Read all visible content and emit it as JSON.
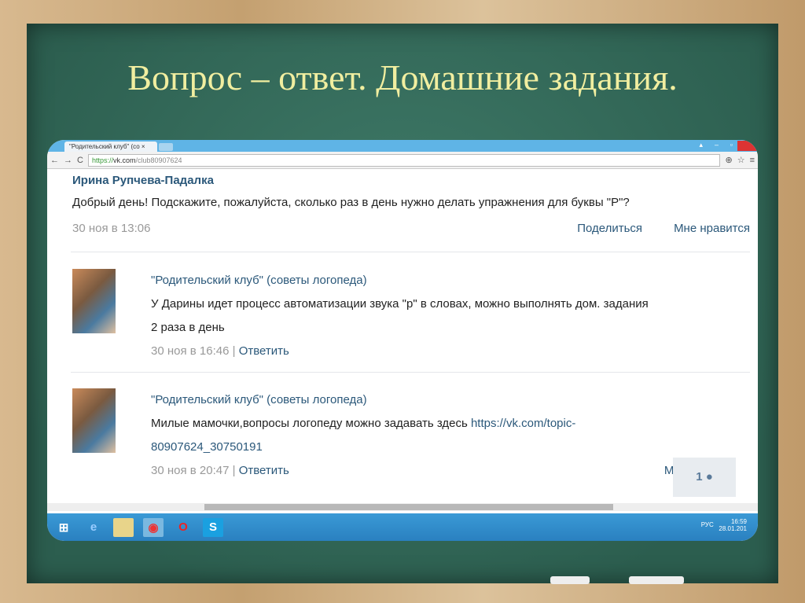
{
  "slide": {
    "title": "Вопрос – ответ. Домашние задания."
  },
  "browser": {
    "tab_title": "\"Родительский клуб\" (со",
    "url_scheme": "https://",
    "url_host": "vk.com",
    "url_path": "/club80907624"
  },
  "question": {
    "author": "Ирина Рупчева-Падалка",
    "text": "Добрый день! Подскажите, пожалуйста, сколько раз в день нужно делать упражнения для буквы \"Р\"?",
    "date": "30 ноя в 13:06",
    "share": "Поделиться",
    "like": "Мне нравится"
  },
  "replies": [
    {
      "author": "\"Родительский клуб\" (советы логопеда)",
      "text": "У Дарины идет процесс автоматизации звука \"р\" в словах, можно выполнять дом. задания",
      "text2": "2 раза в день",
      "date": "30 ноя в 16:46",
      "reply": "Ответить"
    },
    {
      "author": "\"Родительский клуб\" (советы логопеда)",
      "text": "Милые мамочки,вопросы логопеду можно задавать здесь ",
      "link": "https://vk.com/topic-",
      "link2": "80907624_30750191",
      "date": "30 ноя в 20:47",
      "reply": "Ответить",
      "like_partial": "Мне"
    }
  ],
  "like_count": "1",
  "taskbar": {
    "lang": "РУС",
    "time": "16:59",
    "date": "28.01.201"
  }
}
